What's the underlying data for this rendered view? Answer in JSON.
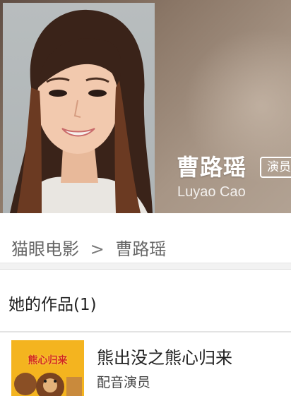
{
  "profile": {
    "name_cn": "曹路瑶",
    "role_badge": "演员",
    "name_en": "Luyao Cao"
  },
  "breadcrumb": {
    "home": "猫眼电影",
    "separator": ">",
    "current": "曹路瑶"
  },
  "works": {
    "title": "她的作品(1)",
    "items": [
      {
        "title": "熊出没之熊心归来",
        "role": "配音演员",
        "poster_text": "熊心归来"
      }
    ]
  },
  "colors": {
    "header_bg": "#8a7666",
    "poster_bg": "#f3b21c",
    "text_primary": "#222222",
    "text_secondary": "#666666"
  },
  "icons": [
    "actor-photo",
    "movie-poster"
  ]
}
